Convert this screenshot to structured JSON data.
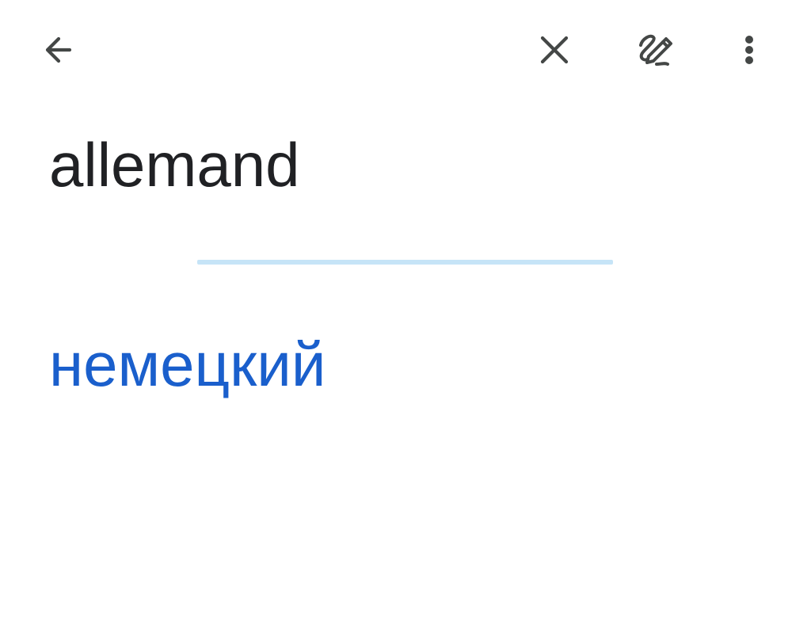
{
  "toolbar": {
    "back_icon": "arrow-back-icon",
    "clear_icon": "close-icon",
    "handwrite_icon": "handwriting-pen-icon",
    "more_icon": "more-vert-icon",
    "icon_color": "#444746"
  },
  "source": {
    "text": "allemand",
    "color": "#202124"
  },
  "divider": {
    "color": "#c6e4f7"
  },
  "translation": {
    "text": "немецкий",
    "color": "#1a5fcc"
  }
}
